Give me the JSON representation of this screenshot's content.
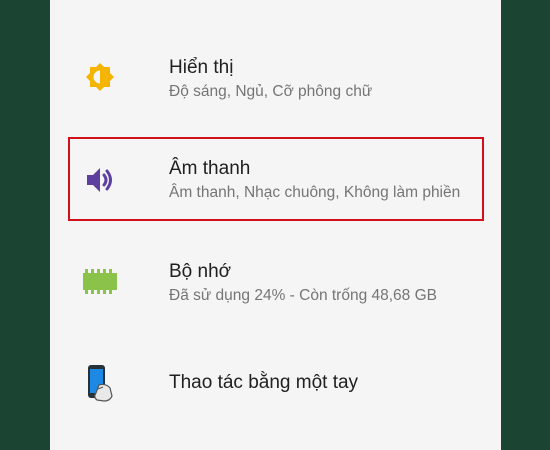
{
  "settings": {
    "items": [
      {
        "icon": "brightness-icon",
        "title": "Hiển thị",
        "subtitle": "Độ sáng, Ngủ, Cỡ phông chữ"
      },
      {
        "icon": "speaker-icon",
        "title": "Âm thanh",
        "subtitle": "Âm thanh, Nhạc chuông, Không làm phiền"
      },
      {
        "icon": "memory-chip-icon",
        "title": "Bộ nhớ",
        "subtitle": "Đã sử dụng 24% - Còn trống 48,68 GB"
      },
      {
        "icon": "one-hand-phone-icon",
        "title": "Thao tác bằng một tay"
      }
    ]
  },
  "colors": {
    "background": "#1b4433",
    "panel": "#f5f5f5",
    "display_icon": "#f4b400",
    "sound_icon": "#5c3f9e",
    "storage_icon": "#8bc34a",
    "phone_icon": "#1e88e5",
    "highlight_border": "#d0111b"
  }
}
